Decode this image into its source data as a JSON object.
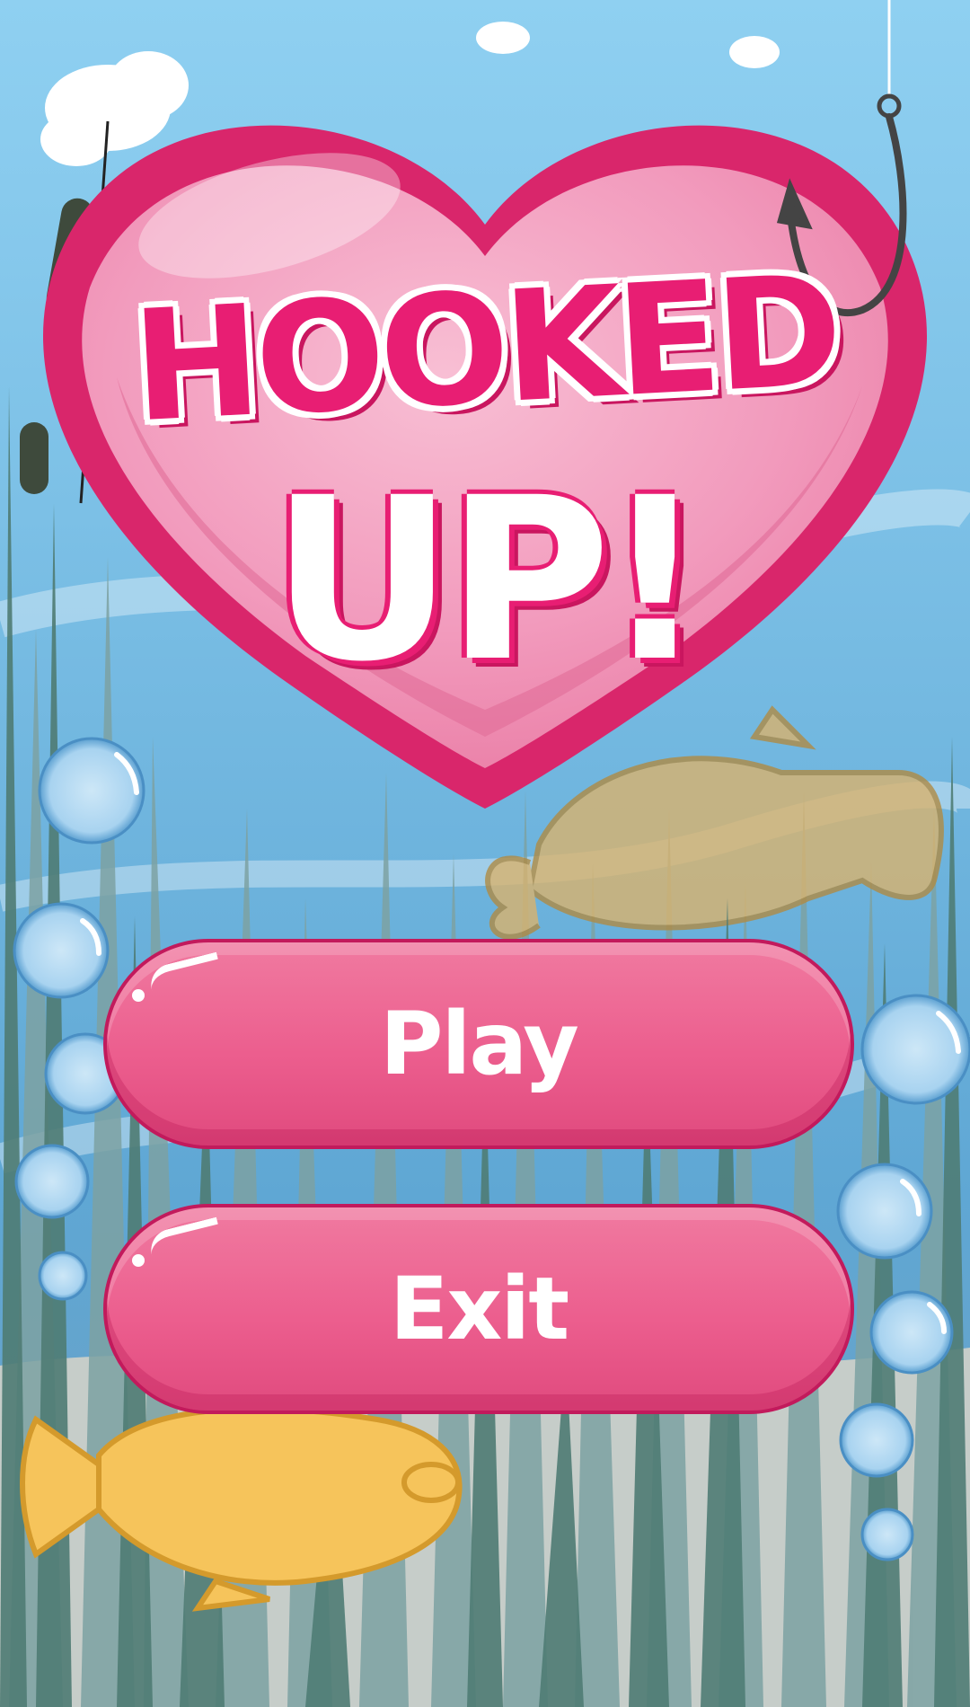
{
  "title": {
    "line1": "HOOKED",
    "line2": "UP!"
  },
  "menu": {
    "play_label": "Play",
    "exit_label": "Exit"
  },
  "colors": {
    "sky": "#8fd0f1",
    "water": "#6fb2dc",
    "heart_outer": "#d9266b",
    "heart_inner": "#f49bbd",
    "title_pink": "#e81e73",
    "button_pink": "#ec5e8e",
    "reed": "#4f7c74",
    "fish_yellow": "#f6c45b",
    "fish_tan": "#d9b36e",
    "sand": "#c9cfca"
  }
}
